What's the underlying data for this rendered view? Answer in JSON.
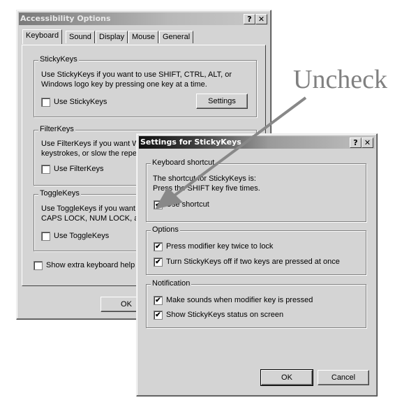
{
  "annotation": {
    "text": "Uncheck",
    "arrow_color": "#888888"
  },
  "main": {
    "title": "Accessibility Options",
    "help_btn": "?",
    "close_btn": "✕",
    "tabs": [
      "Keyboard",
      "Sound",
      "Display",
      "Mouse",
      "General"
    ],
    "active_tab": "Keyboard",
    "sticky": {
      "label": "StickyKeys",
      "desc1": "Use StickyKeys if you want to use SHIFT, CTRL, ALT, or",
      "desc2": "Windows logo key by pressing one key at a time.",
      "checkbox": "Use StickyKeys",
      "checked": false,
      "settings": "Settings"
    },
    "filter": {
      "label": "FilterKeys",
      "desc1": "Use FilterKeys if you want Wi",
      "desc2": "keystrokes, or slow the repea",
      "checkbox": "Use FilterKeys",
      "checked": false
    },
    "toggle": {
      "label": "ToggleKeys",
      "desc1": "Use ToggleKeys if you want t",
      "desc2": "CAPS LOCK, NUM LOCK, ar",
      "checkbox": "Use ToggleKeys",
      "checked": false
    },
    "extra": {
      "checkbox": "Show extra keyboard help i",
      "checked": false
    },
    "ok": "OK"
  },
  "dialog": {
    "title": "Settings for StickyKeys",
    "help_btn": "?",
    "close_btn": "✕",
    "shortcut": {
      "label": "Keyboard shortcut",
      "desc1": "The shortcut for StickyKeys is:",
      "desc2": "Press the SHIFT key five times.",
      "checkbox": "Use shortcut",
      "checked": true
    },
    "options": {
      "label": "Options",
      "items": [
        {
          "label": "Press modifier key twice to lock",
          "checked": true
        },
        {
          "label": "Turn StickyKeys off if two keys are pressed at once",
          "checked": true
        }
      ]
    },
    "notification": {
      "label": "Notification",
      "items": [
        {
          "label": "Make sounds when modifier key is pressed",
          "checked": true
        },
        {
          "label": "Show StickyKeys status on screen",
          "checked": true
        }
      ]
    },
    "ok": "OK",
    "cancel": "Cancel",
    "check_glyph": "✔"
  }
}
